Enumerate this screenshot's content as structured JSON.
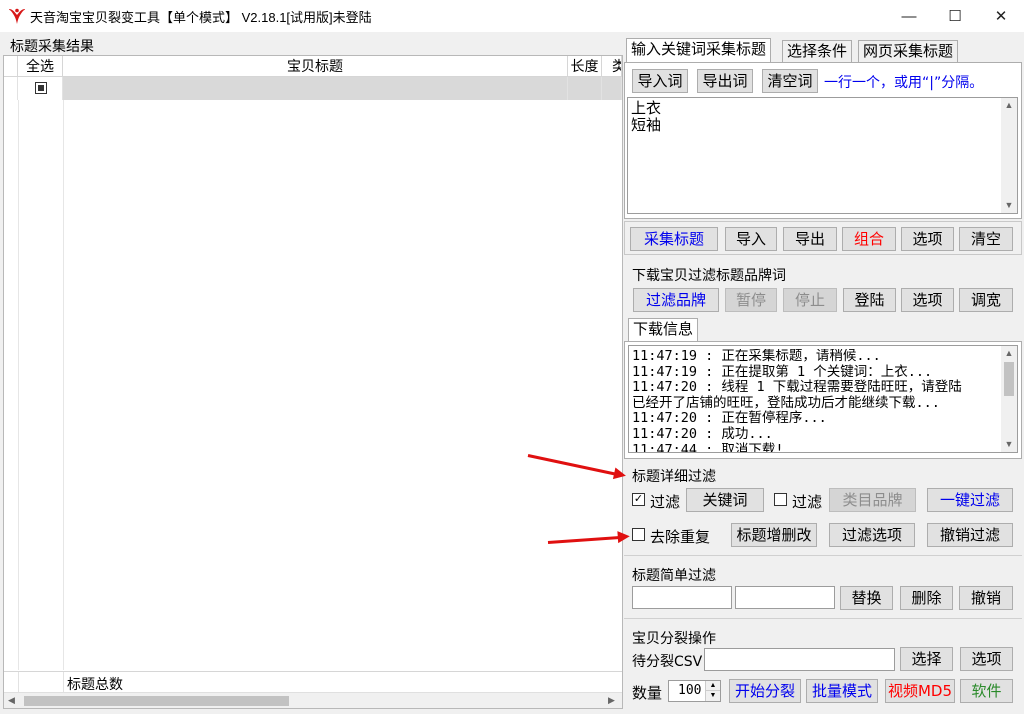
{
  "window": {
    "title": "天音淘宝宝贝裂变工具【单个模式】 V2.18.1[试用版]未登陆",
    "minimize": "—",
    "maximize": "☐",
    "close": "✕"
  },
  "left": {
    "group_label": "标题采集结果",
    "columns": [
      "全选",
      "宝贝标题",
      "长度",
      "类"
    ],
    "total_label": "标题总数"
  },
  "keyword_tabs": {
    "tabs": [
      "输入关键词采集标题",
      "选择条件",
      "网页采集标题"
    ],
    "import_words": "导入词",
    "export_words": "导出词",
    "clear_words": "清空词",
    "hint": "一行一个，或用“|”分隔。",
    "keywords": [
      "上衣",
      "短袖"
    ]
  },
  "collect_row": {
    "collect": "采集标题",
    "import": "导入",
    "export": "导出",
    "combine": "组合",
    "options": "选项",
    "clear": "清空"
  },
  "brand_filter": {
    "label": "下载宝贝过滤标题品牌词",
    "filter": "过滤品牌",
    "pause": "暂停",
    "stop": "停止",
    "login": "登陆",
    "options": "选项",
    "widen": "调宽"
  },
  "download_info": {
    "tab": "下载信息",
    "lines": [
      "11:47:19 : 正在采集标题，请稍候...",
      "11:47:19 : 正在提取第 1 个关键词：上衣...",
      "11:47:20 : 线程 1 下载过程需要登陆旺旺，请登陆",
      "已经开了店铺的旺旺，登陆成功后才能继续下载...",
      "11:47:20 : 正在暂停程序...",
      "11:47:20 : 成功...",
      "11:47:44 : 取消下载!"
    ]
  },
  "detail_filter": {
    "label": "标题详细过滤",
    "filter1_label": "过滤",
    "filter1_checked": true,
    "keyword_btn": "关键词",
    "filter2_label": "过滤",
    "filter2_checked": false,
    "category_brand": "类目品牌",
    "one_key": "一键过滤",
    "dedupe_label": "去除重复",
    "dedupe_checked": false,
    "title_edit": "标题增删改",
    "filter_options": "过滤选项",
    "undo_filter": "撤销过滤"
  },
  "simple_filter": {
    "label": "标题简单过滤",
    "input1": "",
    "input2": "",
    "replace": "替换",
    "delete": "删除",
    "undo": "撤销"
  },
  "split": {
    "label": "宝贝分裂操作",
    "csv_label": "待分裂CSV",
    "csv_value": "",
    "select": "选择",
    "options": "选项",
    "count_label": "数量",
    "count_value": "100",
    "start": "开始分裂",
    "batch": "批量模式",
    "video_md5": "视频MD5",
    "software": "软件"
  },
  "colors": {
    "blue_text": "#0000ee",
    "red_text": "#ff0000",
    "arrow": "#e01010"
  }
}
